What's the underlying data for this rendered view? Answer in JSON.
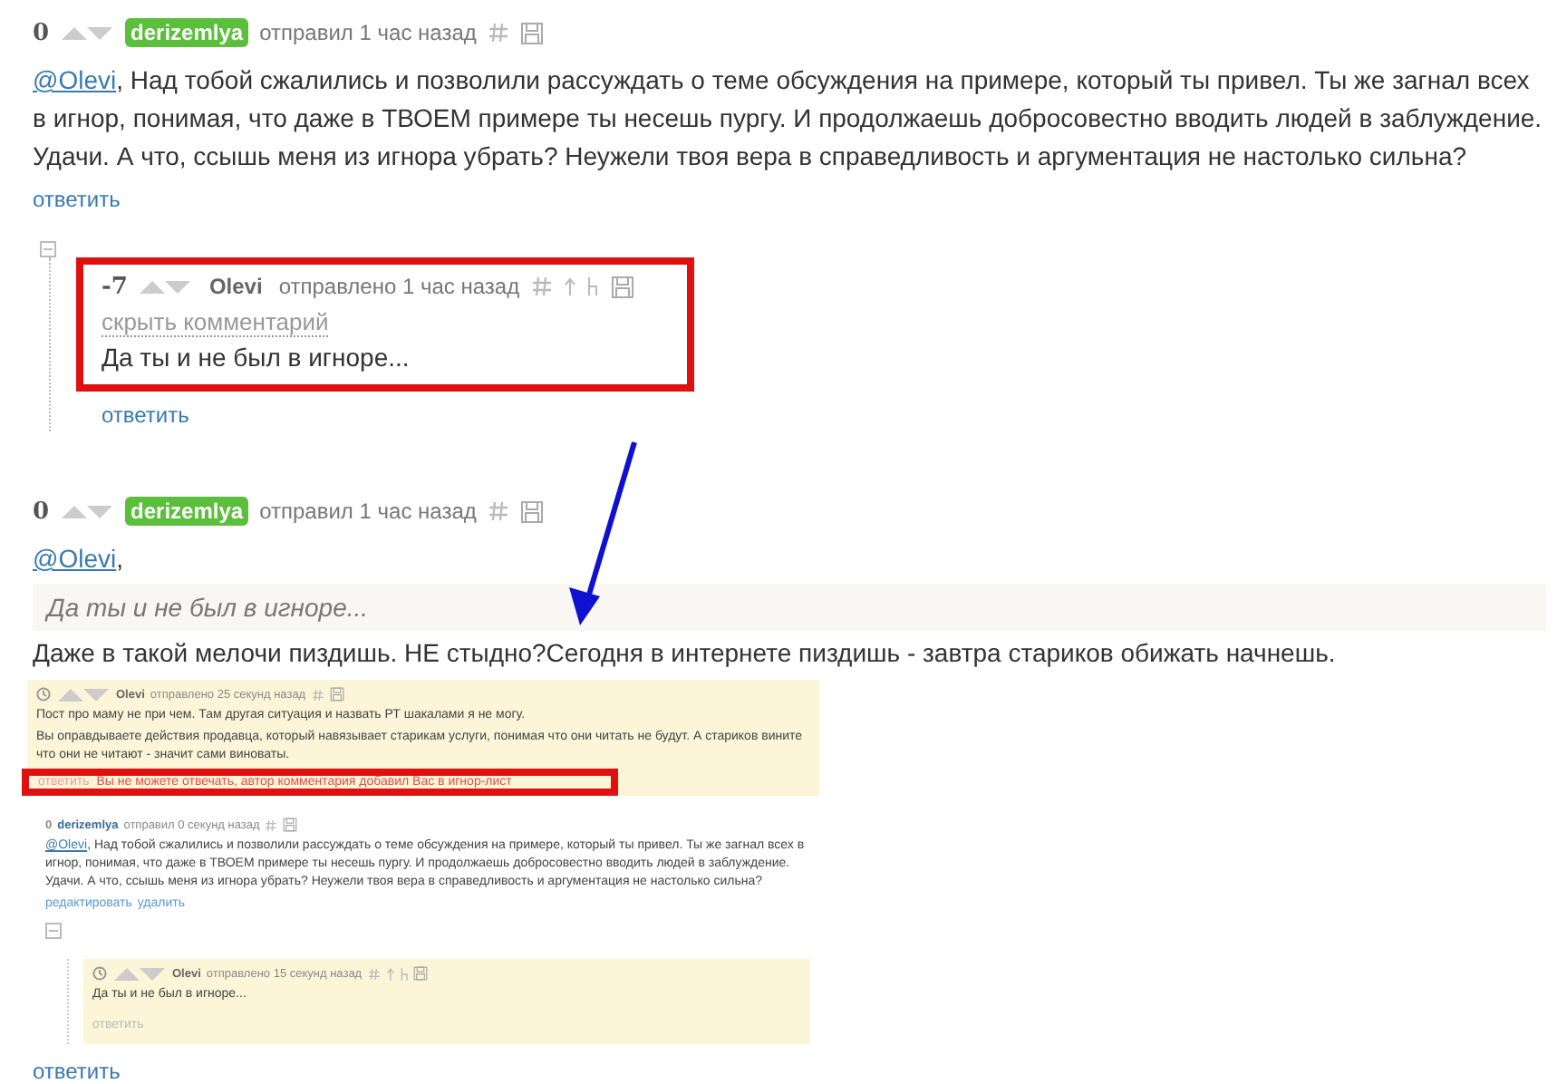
{
  "comments": [
    {
      "score": "0",
      "author": "derizemlya",
      "badge": true,
      "meta": "отправил 1 час назад",
      "mention": "@Olevi",
      "body": ", Над тобой сжалились и позволили рассуждать о теме обсуждения на примере, который ты привел. Ты же загнал всех в игнор, понимая, что даже в ТВОЕМ примере ты несешь пургу. И продолжаешь добросовестно вводить людей в заблуждение. Удачи. А что, ссышь меня из игнора убрать? Неужели твоя вера в справедливость и аргументация не настолько сильна?",
      "reply": "ответить",
      "children": [
        {
          "score": "-7",
          "author": "Olevi",
          "badge": false,
          "meta": "отправлено 1 час назад",
          "hide": "скрыть комментарий",
          "body": "Да ты и не был в игноре...",
          "reply": "ответить",
          "highlighted": true
        }
      ]
    },
    {
      "score": "0",
      "author": "derizemlya",
      "badge": true,
      "meta": "отправил 1 час назад",
      "mention": "@Olevi",
      "mention_tail": ",",
      "quote": "Да ты и не был в игноре...",
      "body": "Даже в такой мелочи пиздишь. НЕ стыдно?Сегодня в интернете пиздишь - завтра стариков обижать начнешь.",
      "reply": "ответить",
      "screenshot": {
        "comments": [
          {
            "author": "Olevi",
            "meta": "отправлено 25 секунд назад",
            "unread": true,
            "paragraphs": [
              "Пост про маму не при чем. Там другая ситуация и назвать РТ шакалами я не могу.",
              "Вы оправдываете действия продавца, который навязывает старикам услуги, понимая что они читать не будут. А стариков вините что они не читают - значит сами виноваты."
            ],
            "reply": "ответить",
            "notice": "Вы не можете отвечать, автор комментария добавил Вас в игнор-лист",
            "highlighted": true
          },
          {
            "score": "0",
            "author": "derizemlya",
            "meta": "отправил 0 секунд назад",
            "unread": false,
            "mention": "@Olevi",
            "body": ", Над тобой сжалились и позволили рассуждать о теме обсуждения на примере, который ты привел. Ты же загнал всех в игнор, понимая, что даже в ТВОЕМ примере ты несешь пургу. И продолжаешь добросовестно вводить людей в заблуждение. Удачи. А что, ссышь меня из игнора убрать? Неужели твоя вера в справедливость и аргументация не настолько сильна?",
            "actions": [
              "редактировать",
              "удалить"
            ],
            "children": [
              {
                "author": "Olevi",
                "meta": "отправлено 15 секунд назад",
                "unread": true,
                "body": "Да ты и не был в игноре...",
                "reply": "ответить"
              }
            ]
          }
        ]
      }
    }
  ]
}
